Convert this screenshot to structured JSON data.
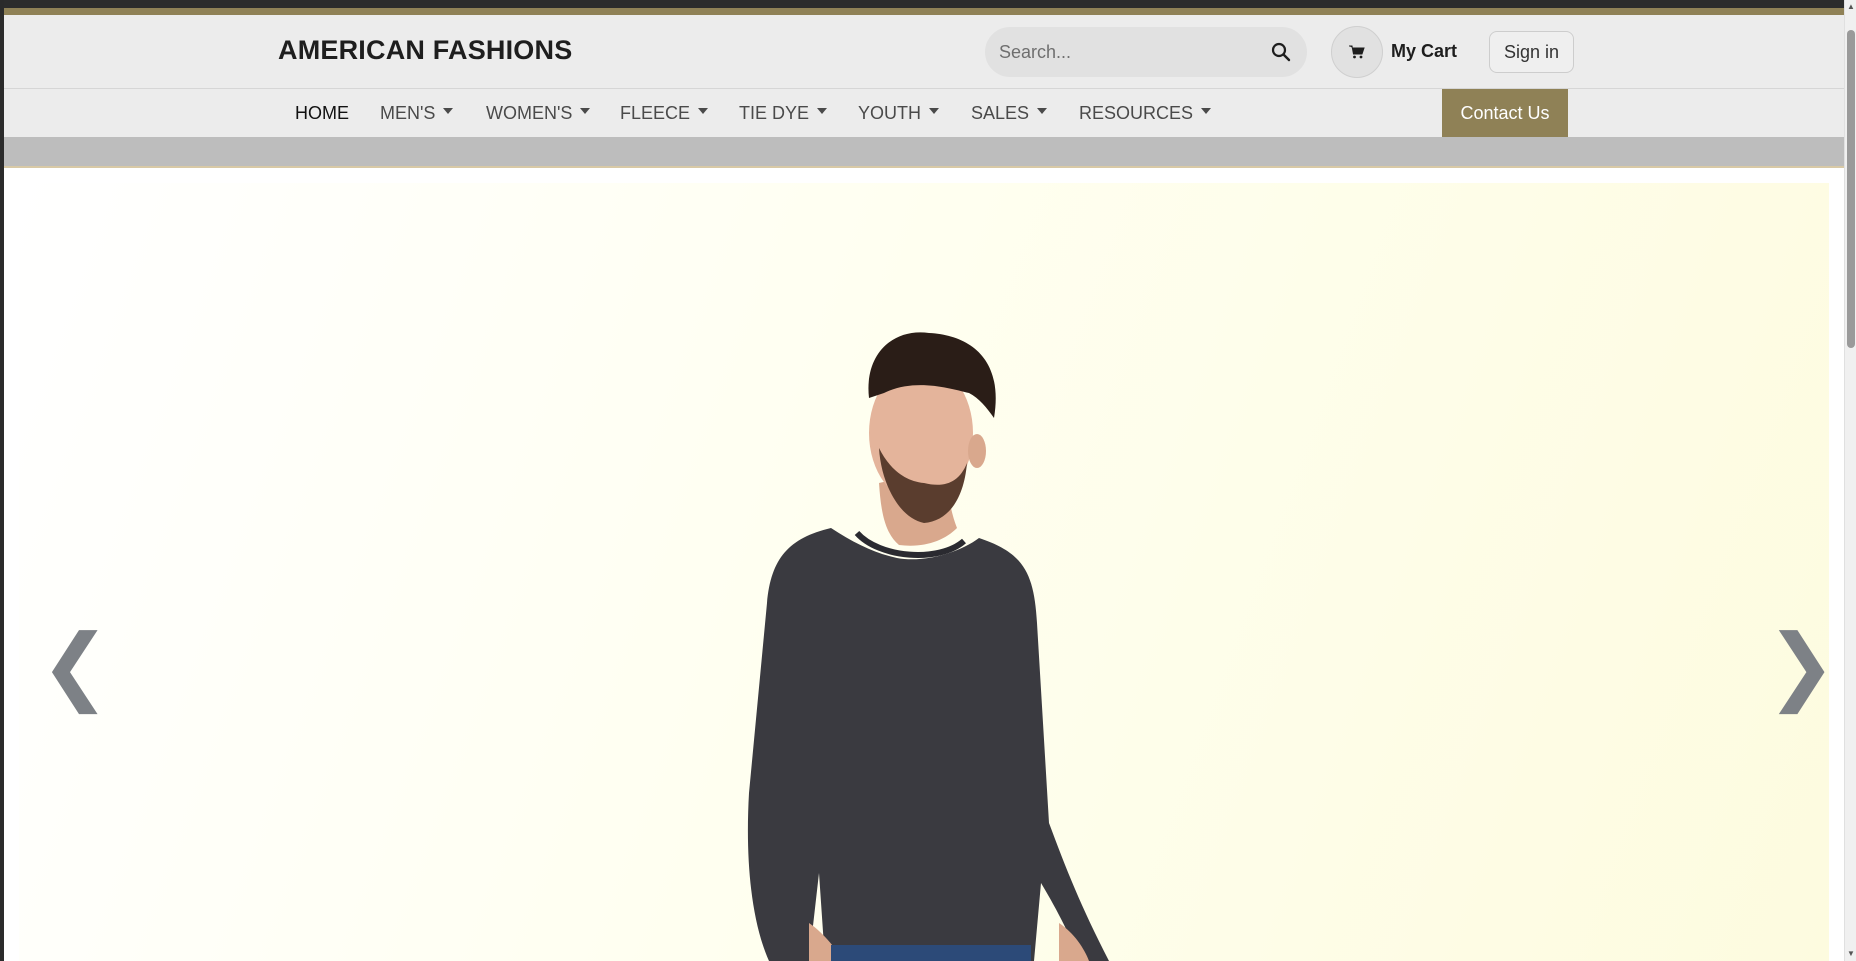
{
  "brand": {
    "name": "AMERICAN FASHIONS"
  },
  "search": {
    "placeholder": "Search..."
  },
  "cart": {
    "label": "My Cart"
  },
  "signin": {
    "label": "Sign in"
  },
  "nav": {
    "items": [
      {
        "label": "HOME",
        "dropdown": false
      },
      {
        "label": "MEN'S",
        "dropdown": true
      },
      {
        "label": "WOMEN'S",
        "dropdown": true
      },
      {
        "label": "FLEECE",
        "dropdown": true
      },
      {
        "label": "TIE DYE",
        "dropdown": true
      },
      {
        "label": "YOUTH",
        "dropdown": true
      },
      {
        "label": "SALES",
        "dropdown": true
      },
      {
        "label": "RESOURCES",
        "dropdown": true
      }
    ],
    "contact_label": "Contact Us"
  },
  "carousel": {
    "prev_glyph": "❮",
    "next_glyph": "❯"
  },
  "colors": {
    "accent_gold": "#8f8156",
    "header_bg": "#ececec",
    "band_grey": "#bdbdbd",
    "shirt": "#3a3a40",
    "hero_bg": "#fffff0"
  },
  "icons": {
    "search": "magnifier-icon",
    "cart": "cart-icon"
  }
}
